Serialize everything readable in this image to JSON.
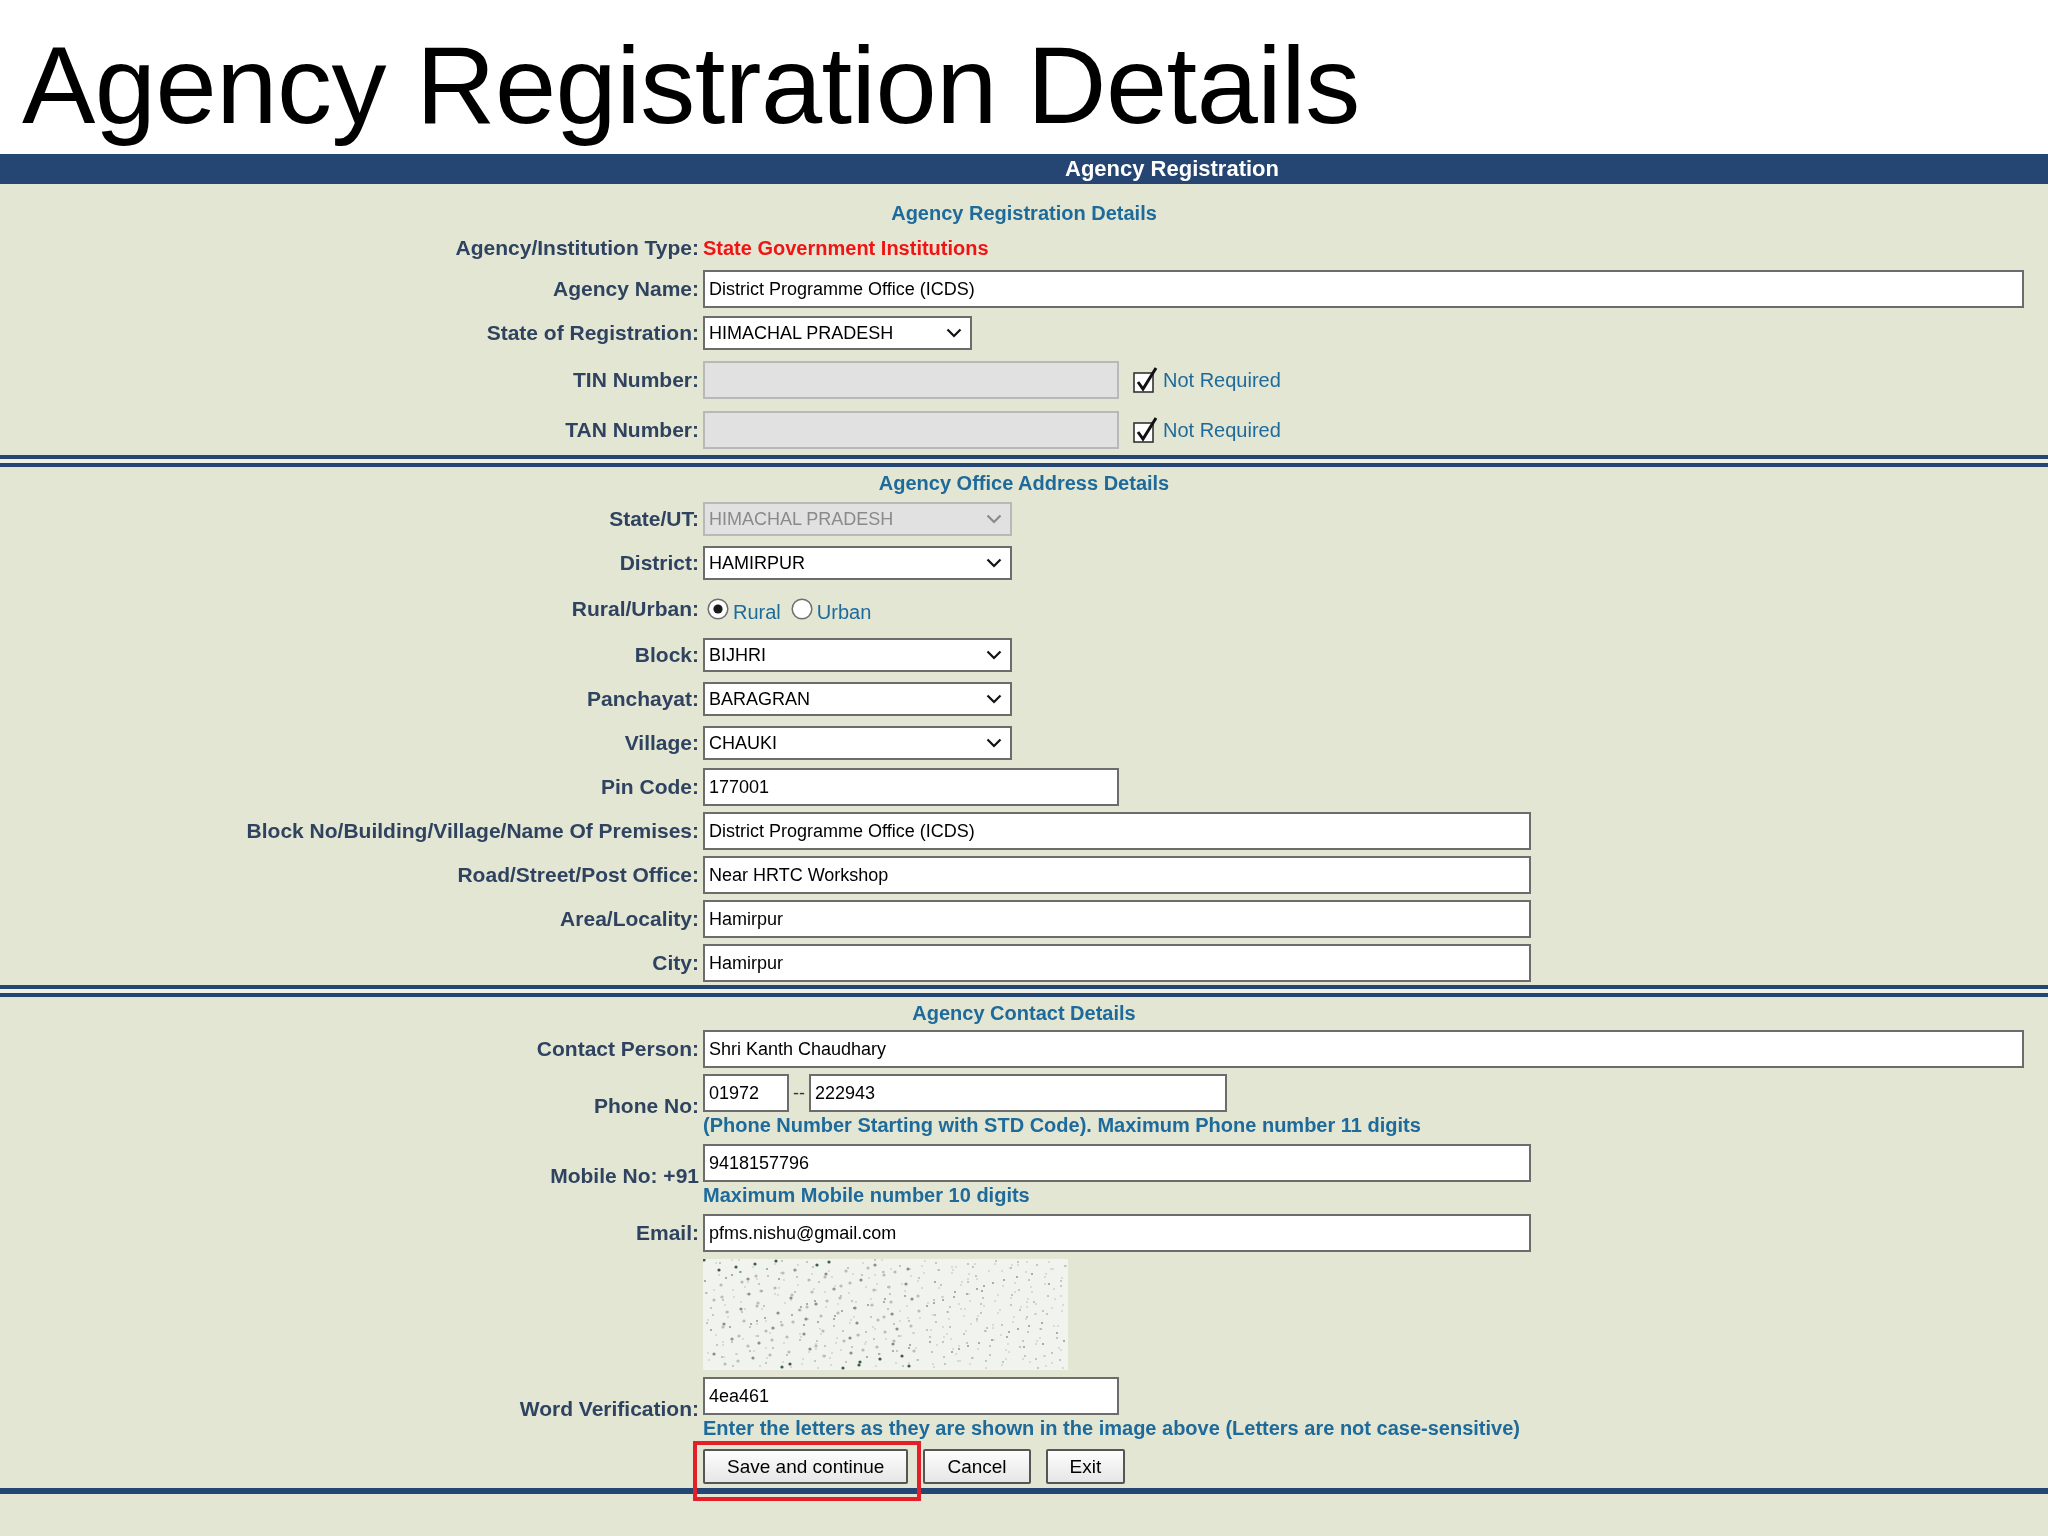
{
  "slide_title": "Agency Registration Details",
  "form": {
    "title": "Agency Registration",
    "sections": [
      {
        "heading": "Agency Registration Details",
        "fields": [
          {
            "kind": "static",
            "label": "Agency/Institution Type:",
            "value": "State Government Institutions"
          },
          {
            "kind": "text",
            "label": "Agency Name:",
            "value": "District Programme Office (ICDS)",
            "disabled": false
          },
          {
            "kind": "select",
            "label": "State of Registration:",
            "value": "HIMACHAL PRADESH",
            "disabled": false
          },
          {
            "kind": "text",
            "label": "TIN Number:",
            "disabled": true,
            "option": {
              "label": "Not Required",
              "checked": true
            }
          },
          {
            "kind": "text",
            "label": "TAN Number:",
            "disabled": true,
            "option": {
              "label": "Not Required",
              "checked": true
            }
          }
        ]
      },
      {
        "heading": "Agency Office Address Details",
        "fields": [
          {
            "kind": "select",
            "label": "State/UT:",
            "value": "HIMACHAL PRADESH",
            "disabled": true
          },
          {
            "kind": "select",
            "label": "District:",
            "value": "HAMIRPUR",
            "disabled": false
          },
          {
            "kind": "radio",
            "label": "Rural/Urban:",
            "options": [
              {
                "label": "Rural",
                "selected": true
              },
              {
                "label": "Urban",
                "selected": false
              }
            ]
          },
          {
            "kind": "select",
            "label": "Block:",
            "value": "BIJHRI",
            "disabled": false
          },
          {
            "kind": "select",
            "label": "Panchayat:",
            "value": "BARAGRAN",
            "disabled": false
          },
          {
            "kind": "select",
            "label": "Village:",
            "value": "CHAUKI",
            "disabled": false
          },
          {
            "kind": "text",
            "label": "Pin Code:",
            "value": "177001",
            "disabled": false
          },
          {
            "kind": "text",
            "label": "Block No/Building/Village/Name Of Premises:",
            "value": "District Programme Office (ICDS)",
            "disabled": false
          },
          {
            "kind": "text",
            "label": "Road/Street/Post Office:",
            "value": "Near HRTC Workshop",
            "disabled": false
          },
          {
            "kind": "text",
            "label": "Area/Locality:",
            "value": "Hamirpur",
            "disabled": false
          },
          {
            "kind": "text",
            "label": "City:",
            "value": "Hamirpur",
            "disabled": false
          }
        ]
      },
      {
        "heading": "Agency Contact Details",
        "fields": [
          {
            "kind": "text",
            "label": "Contact Person:",
            "value": "Shri Kanth Chaudhary",
            "disabled": false
          },
          {
            "kind": "phone",
            "label": "Phone No:",
            "std_code": "01972",
            "separator": "--",
            "number": "222943",
            "hint": "(Phone Number Starting with STD Code). Maximum Phone number 11 digits"
          },
          {
            "kind": "text",
            "label": "Mobile No: +91",
            "value": "9418157796",
            "disabled": false,
            "hint": "Maximum Mobile number 10 digits"
          },
          {
            "kind": "text",
            "label": "Email:",
            "value": "pfms.nishu@gmail.com",
            "disabled": false
          },
          {
            "kind": "captcha"
          },
          {
            "kind": "text",
            "label": "Word Verification:",
            "value": "4ea461",
            "disabled": false,
            "hint": "Enter the letters as they are shown in the image above (Letters are not case-sensitive)"
          }
        ]
      }
    ],
    "buttons": [
      {
        "label": "Save and continue",
        "highlighted": true
      },
      {
        "label": "Cancel",
        "highlighted": false
      },
      {
        "label": "Exit",
        "highlighted": false
      }
    ]
  }
}
